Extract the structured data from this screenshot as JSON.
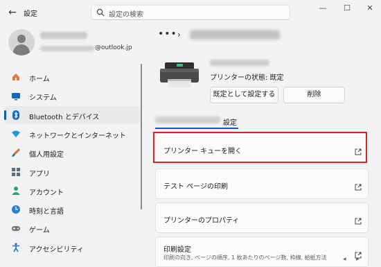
{
  "titlebar": {
    "back_icon": "back-arrow-icon",
    "title": "設定",
    "search_placeholder": "設定の検索",
    "minimize": "—",
    "maximize": "☐",
    "close": "✕"
  },
  "profile": {
    "email_suffix": "@outlook.jp"
  },
  "sidebar": {
    "items": [
      {
        "label": "ホーム",
        "icon": "home-icon",
        "color": "#e8793a"
      },
      {
        "label": "システム",
        "icon": "system-icon",
        "color": "#0f6cbd"
      },
      {
        "label": "Bluetooth とデバイス",
        "icon": "bluetooth-icon",
        "color": "#0f6cbd",
        "active": true
      },
      {
        "label": "ネットワークとインターネット",
        "icon": "wifi-icon",
        "color": "#1e9bd7"
      },
      {
        "label": "個人用設定",
        "icon": "brush-icon",
        "color": "#d86a2a"
      },
      {
        "label": "アプリ",
        "icon": "apps-icon",
        "color": "#5c6e84"
      },
      {
        "label": "アカウント",
        "icon": "account-icon",
        "color": "#2aa37a"
      },
      {
        "label": "時刻と言語",
        "icon": "globe-clock-icon",
        "color": "#2b7fd0"
      },
      {
        "label": "ゲーム",
        "icon": "gamepad-icon",
        "color": "#767676"
      },
      {
        "label": "アクセシビリティ",
        "icon": "accessibility-icon",
        "color": "#1b6fc6"
      }
    ]
  },
  "main": {
    "breadcrumb_dots": "•••",
    "breadcrumb_chevron": "›",
    "printer_status": "プリンターの状態:  既定",
    "set_default_button": "既定として設定する",
    "delete_button": "削除",
    "tab_label": "設定",
    "cards": [
      {
        "label": "プリンター キューを開く",
        "sub": ""
      },
      {
        "label": "テスト ページの印刷",
        "sub": ""
      },
      {
        "label": "プリンターのプロパティ",
        "sub": ""
      },
      {
        "label": "印刷設定",
        "sub": "印刷の向き, ページの順序, 1 枚あたりのページ数, 枠線, 給紙方法"
      }
    ]
  },
  "colors": {
    "accent": "#005fb8",
    "highlight": "#d9222a"
  }
}
